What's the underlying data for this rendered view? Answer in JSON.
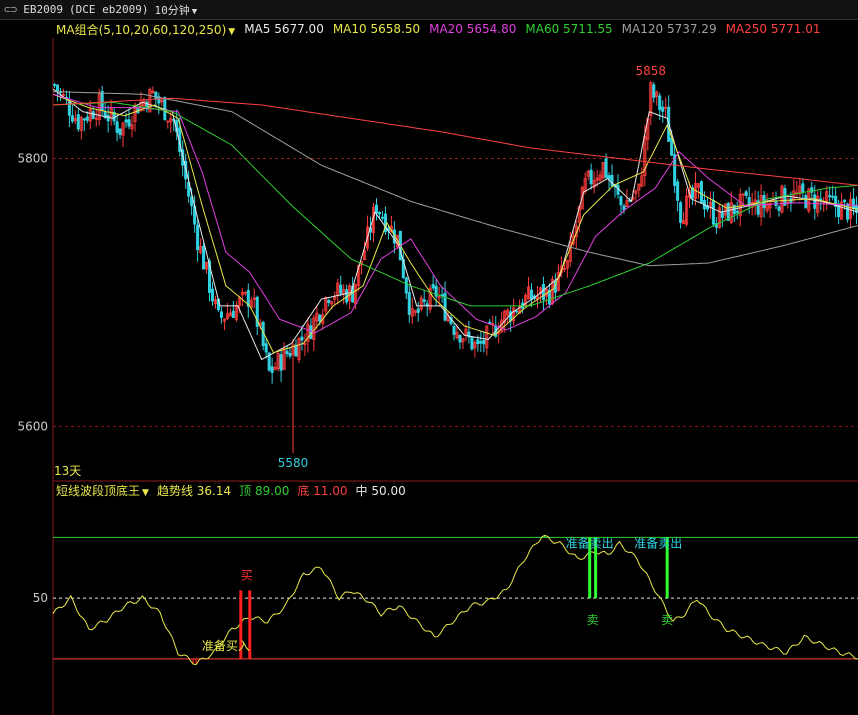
{
  "header": {
    "window_icon": "link-icon",
    "symbol": "EB2009",
    "contract": "(DCE eb2009)",
    "period": "10分钟"
  },
  "ma_legend": {
    "group_label": "MA组合(5,10,20,60,120,250)",
    "items": [
      {
        "label": "MA5",
        "value": "5677.00",
        "color": "#e8e8e8"
      },
      {
        "label": "MA10",
        "value": "5658.50",
        "color": "#e8e84a"
      },
      {
        "label": "MA20",
        "value": "5654.80",
        "color": "#e040e0"
      },
      {
        "label": "MA60",
        "value": "5711.55",
        "color": "#30d030"
      },
      {
        "label": "MA120",
        "value": "5737.29",
        "color": "#a0a0a0"
      },
      {
        "label": "MA250",
        "value": "5771.01",
        "color": "#ff4040"
      }
    ]
  },
  "price_panel": {
    "y_ticks": [
      "5800",
      "5600"
    ],
    "high_label": "5858",
    "low_label": "5580",
    "period_tag": "13天"
  },
  "indicator": {
    "name": "短线波段顶底王",
    "trend_label": "趋势线",
    "trend_value": "36.14",
    "top_label": "顶",
    "top_value": "89.00",
    "bottom_label": "底",
    "bottom_value": "11.00",
    "mid_label": "中",
    "mid_value": "50.00",
    "y_tick": "50",
    "signal_prepare_buy": "准备买入",
    "signal_buy": "买",
    "signal_prepare_sell_1": "准备卖出",
    "signal_prepare_sell_2": "准备卖出",
    "signal_sell_1": "卖",
    "signal_sell_2": "卖"
  },
  "colors": {
    "up": "#ff3c3c",
    "down": "#30d0e0",
    "buy_signal": "#ff2020",
    "sell_signal": "#30ff30",
    "trend_line": "#e8e84a"
  },
  "chart_data": [
    {
      "type": "candlestick",
      "title": "",
      "ylim": [
        5560,
        5890
      ],
      "y_ticks": [
        5600,
        5800
      ],
      "grid": true,
      "series": [
        {
          "name": "K",
          "anchors": [
            [
              0,
              5855
            ],
            [
              8,
              5828
            ],
            [
              15,
              5840
            ],
            [
              22,
              5822
            ],
            [
              28,
              5840
            ],
            [
              33,
              5848
            ],
            [
              40,
              5828
            ],
            [
              48,
              5740
            ],
            [
              55,
              5680
            ],
            [
              60,
              5688
            ],
            [
              66,
              5698
            ],
            [
              72,
              5640
            ],
            [
              78,
              5655
            ],
            [
              85,
              5670
            ],
            [
              92,
              5700
            ],
            [
              100,
              5700
            ],
            [
              108,
              5765
            ],
            [
              115,
              5740
            ],
            [
              120,
              5680
            ],
            [
              128,
              5700
            ],
            [
              134,
              5675
            ],
            [
              142,
              5658
            ],
            [
              150,
              5680
            ],
            [
              158,
              5695
            ],
            [
              166,
              5700
            ],
            [
              172,
              5720
            ],
            [
              178,
              5780
            ],
            [
              184,
              5795
            ],
            [
              190,
              5765
            ],
            [
              196,
              5775
            ],
            [
              200,
              5850
            ],
            [
              205,
              5832
            ],
            [
              210,
              5760
            ],
            [
              216,
              5775
            ],
            [
              222,
              5755
            ],
            [
              230,
              5765
            ],
            [
              238,
              5765
            ],
            [
              246,
              5773
            ],
            [
              254,
              5770
            ],
            [
              262,
              5765
            ],
            [
              270,
              5758
            ]
          ]
        },
        {
          "name": "MA5",
          "anchors": [
            [
              0,
              5852
            ],
            [
              10,
              5835
            ],
            [
              20,
              5830
            ],
            [
              30,
              5842
            ],
            [
              40,
              5835
            ],
            [
              48,
              5760
            ],
            [
              56,
              5690
            ],
            [
              62,
              5690
            ],
            [
              70,
              5650
            ],
            [
              80,
              5662
            ],
            [
              90,
              5695
            ],
            [
              100,
              5700
            ],
            [
              108,
              5760
            ],
            [
              116,
              5735
            ],
            [
              122,
              5690
            ],
            [
              130,
              5690
            ],
            [
              138,
              5668
            ],
            [
              146,
              5665
            ],
            [
              154,
              5685
            ],
            [
              162,
              5697
            ],
            [
              170,
              5712
            ],
            [
              178,
              5775
            ],
            [
              186,
              5785
            ],
            [
              194,
              5768
            ],
            [
              200,
              5835
            ],
            [
              206,
              5830
            ],
            [
              214,
              5770
            ],
            [
              224,
              5760
            ],
            [
              234,
              5765
            ],
            [
              246,
              5772
            ],
            [
              258,
              5768
            ],
            [
              270,
              5760
            ]
          ]
        },
        {
          "name": "MA10",
          "anchors": [
            [
              0,
              5848
            ],
            [
              12,
              5838
            ],
            [
              24,
              5832
            ],
            [
              34,
              5840
            ],
            [
              42,
              5830
            ],
            [
              50,
              5765
            ],
            [
              58,
              5705
            ],
            [
              66,
              5690
            ],
            [
              74,
              5655
            ],
            [
              84,
              5662
            ],
            [
              94,
              5690
            ],
            [
              104,
              5705
            ],
            [
              112,
              5752
            ],
            [
              120,
              5722
            ],
            [
              128,
              5695
            ],
            [
              138,
              5675
            ],
            [
              148,
              5668
            ],
            [
              158,
              5688
            ],
            [
              168,
              5703
            ],
            [
              178,
              5758
            ],
            [
              188,
              5780
            ],
            [
              198,
              5790
            ],
            [
              206,
              5825
            ],
            [
              214,
              5778
            ],
            [
              226,
              5763
            ],
            [
              240,
              5768
            ],
            [
              255,
              5770
            ],
            [
              270,
              5762
            ]
          ]
        },
        {
          "name": "MA20",
          "anchors": [
            [
              0,
              5848
            ],
            [
              15,
              5838
            ],
            [
              30,
              5838
            ],
            [
              42,
              5835
            ],
            [
              50,
              5790
            ],
            [
              58,
              5730
            ],
            [
              66,
              5715
            ],
            [
              76,
              5680
            ],
            [
              88,
              5670
            ],
            [
              100,
              5685
            ],
            [
              110,
              5725
            ],
            [
              120,
              5740
            ],
            [
              130,
              5705
            ],
            [
              142,
              5680
            ],
            [
              152,
              5672
            ],
            [
              162,
              5682
            ],
            [
              172,
              5700
            ],
            [
              182,
              5742
            ],
            [
              192,
              5762
            ],
            [
              202,
              5778
            ],
            [
              210,
              5805
            ],
            [
              220,
              5785
            ],
            [
              232,
              5765
            ],
            [
              250,
              5767
            ],
            [
              270,
              5765
            ]
          ]
        },
        {
          "name": "MA60",
          "anchors": [
            [
              0,
              5840
            ],
            [
              20,
              5842
            ],
            [
              40,
              5835
            ],
            [
              60,
              5810
            ],
            [
              80,
              5765
            ],
            [
              100,
              5725
            ],
            [
              120,
              5705
            ],
            [
              140,
              5690
            ],
            [
              160,
              5690
            ],
            [
              180,
              5705
            ],
            [
              200,
              5722
            ],
            [
              220,
              5748
            ],
            [
              240,
              5770
            ],
            [
              260,
              5778
            ],
            [
              270,
              5780
            ]
          ]
        },
        {
          "name": "MA120",
          "anchors": [
            [
              0,
              5850
            ],
            [
              30,
              5848
            ],
            [
              60,
              5835
            ],
            [
              90,
              5795
            ],
            [
              120,
              5768
            ],
            [
              150,
              5748
            ],
            [
              180,
              5730
            ],
            [
              200,
              5720
            ],
            [
              220,
              5722
            ],
            [
              245,
              5735
            ],
            [
              270,
              5750
            ]
          ]
        },
        {
          "name": "MA250",
          "anchors": [
            [
              0,
              5840
            ],
            [
              40,
              5845
            ],
            [
              70,
              5840
            ],
            [
              100,
              5830
            ],
            [
              130,
              5820
            ],
            [
              160,
              5808
            ],
            [
              190,
              5800
            ],
            [
              220,
              5792
            ],
            [
              250,
              5785
            ],
            [
              270,
              5780
            ]
          ]
        }
      ]
    },
    {
      "type": "line",
      "title": "",
      "ylim": [
        -25,
        113
      ],
      "y_ticks": [
        50
      ],
      "reference_lines": [
        89,
        50,
        11
      ],
      "series": [
        {
          "name": "趋势线",
          "x": [
            0,
            6,
            12,
            18,
            24,
            30,
            36,
            42,
            48,
            54,
            60,
            66,
            72,
            78,
            84,
            90,
            96,
            100,
            106,
            110,
            116,
            122,
            128,
            134,
            140,
            146,
            152,
            158,
            164,
            170,
            176,
            182,
            186,
            190,
            196,
            202,
            208,
            212,
            216,
            220,
            226,
            232,
            238,
            246,
            252,
            258,
            264,
            270
          ],
          "y": [
            40,
            50,
            30,
            36,
            45,
            50,
            40,
            15,
            8,
            15,
            30,
            38,
            35,
            45,
            65,
            70,
            50,
            55,
            48,
            40,
            45,
            35,
            25,
            35,
            45,
            48,
            55,
            75,
            90,
            85,
            75,
            80,
            78,
            85,
            75,
            55,
            35,
            40,
            50,
            40,
            30,
            25,
            20,
            15,
            25,
            20,
            15,
            12
          ]
        }
      ],
      "markers": [
        {
          "label": "准备买入",
          "x": 58
        },
        {
          "label": "买",
          "x": 66
        },
        {
          "label": "准备卖出",
          "x": 182
        },
        {
          "label": "卖",
          "x": 182
        },
        {
          "label": "准备卖出",
          "x": 206
        },
        {
          "label": "卖",
          "x": 206
        }
      ]
    }
  ]
}
